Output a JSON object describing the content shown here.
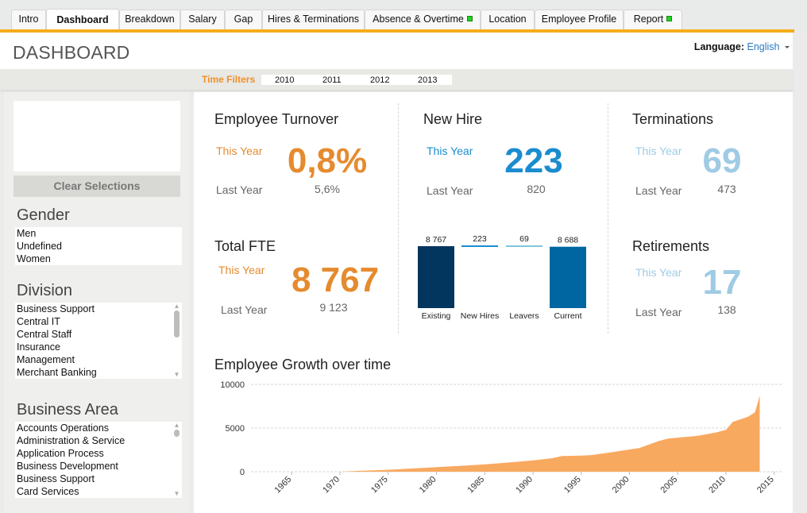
{
  "tabs": [
    {
      "label": "Intro",
      "active": false,
      "indicator": false
    },
    {
      "label": "Dashboard",
      "active": true,
      "indicator": false
    },
    {
      "label": "Breakdown",
      "active": false,
      "indicator": false
    },
    {
      "label": "Salary",
      "active": false,
      "indicator": false
    },
    {
      "label": "Gap",
      "active": false,
      "indicator": false
    },
    {
      "label": "Hires & Terminations",
      "active": false,
      "indicator": false
    },
    {
      "label": "Absence & Overtime",
      "active": false,
      "indicator": true
    },
    {
      "label": "Location",
      "active": false,
      "indicator": false
    },
    {
      "label": "Employee Profile",
      "active": false,
      "indicator": false
    },
    {
      "label": "Report",
      "active": false,
      "indicator": true
    }
  ],
  "header": {
    "title": "DASHBOARD",
    "language_label": "Language:",
    "language_value": "English"
  },
  "time_filters": {
    "label": "Time Filters",
    "years": [
      "2010",
      "2011",
      "2012",
      "2013"
    ]
  },
  "sidebar": {
    "clear_label": "Clear Selections",
    "gender": {
      "title": "Gender",
      "items": [
        "Men",
        "Undefined",
        "Women"
      ]
    },
    "division": {
      "title": "Division",
      "items": [
        "Business Support",
        "Central IT",
        "Central Staff",
        "Insurance",
        "Management",
        "Merchant Banking"
      ]
    },
    "business_area": {
      "title": "Business Area",
      "items": [
        "Accounts Operations",
        "Administration & Service",
        "Application Process",
        "Business Development",
        "Business Support",
        "Card Services"
      ]
    }
  },
  "kpis": {
    "turnover": {
      "title": "Employee Turnover",
      "this_year_label": "This Year",
      "this_year": "0,8%",
      "last_year_label": "Last Year",
      "last_year": "5,6%"
    },
    "new_hire": {
      "title": "New Hire",
      "this_year_label": "This Year",
      "this_year": "223",
      "last_year_label": "Last Year",
      "last_year": "820"
    },
    "terminations": {
      "title": "Terminations",
      "this_year_label": "This Year",
      "this_year": "69",
      "last_year_label": "Last Year",
      "last_year": "473"
    },
    "total_fte": {
      "title": "Total FTE",
      "this_year_label": "This Year",
      "this_year": "8 767",
      "last_year_label": "Last Year",
      "last_year": "9 123"
    },
    "retirements": {
      "title": "Retirements",
      "this_year_label": "This Year",
      "this_year": "17",
      "last_year_label": "Last Year",
      "last_year": "138"
    }
  },
  "colors": {
    "accent_orange": "#e58b2f",
    "accent_blue": "#1a8ccf",
    "light_blue": "#9fcbe4",
    "tab_line": "#f5ad1b",
    "area_fill": "#f8a960",
    "wf_existing": "#03365e",
    "wf_newhires": "#1a8ccf",
    "wf_leavers": "#7fc6dc",
    "wf_current": "#0066a1"
  },
  "chart_data": [
    {
      "type": "bar",
      "title": "",
      "categories": [
        "Existing",
        "New Hires",
        "Leavers",
        "Current"
      ],
      "values": [
        8767,
        223,
        69,
        8688
      ],
      "labels": [
        "8 767",
        "223",
        "69",
        "8 688"
      ],
      "waterfall": true
    },
    {
      "type": "area",
      "title": "Employee Growth over time",
      "xlabel": "",
      "ylabel": "",
      "xlim": [
        1960,
        2016
      ],
      "ylim": [
        0,
        10000
      ],
      "xticks": [
        1965,
        1970,
        1975,
        1980,
        1985,
        1990,
        1995,
        2000,
        2005,
        2010,
        2015
      ],
      "yticks": [
        0,
        5000,
        10000
      ],
      "grid": true,
      "x": [
        1970,
        1972,
        1975,
        1978,
        1980,
        1983,
        1985,
        1988,
        1990,
        1992,
        1993,
        1995,
        1996,
        1998,
        2000,
        2001,
        2002,
        2003,
        2004,
        2005,
        2007,
        2008,
        2009,
        2010,
        2010.7,
        2011.5,
        2012.3,
        2013,
        2013.5
      ],
      "y": [
        0,
        100,
        220,
        400,
        520,
        700,
        850,
        1100,
        1300,
        1550,
        1800,
        1850,
        1900,
        2200,
        2550,
        2700,
        3100,
        3500,
        3800,
        3900,
        4100,
        4300,
        4500,
        4800,
        5700,
        6000,
        6300,
        6800,
        8700
      ]
    }
  ]
}
